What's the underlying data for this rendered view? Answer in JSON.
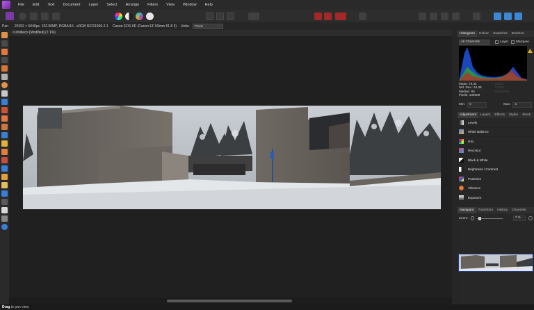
{
  "menubar": {
    "items": [
      "File",
      "Edit",
      "Text",
      "Document",
      "Layer",
      "Select",
      "Arrange",
      "Filters",
      "View",
      "Window",
      "Help"
    ]
  },
  "context_bar": {
    "tool_name": "Pan",
    "doc_info": "20392 × 5046px, 102.90MP, RGBA/16 - sRGB IEC61966-2.1",
    "camera": "Canon EOS 6D (Canon EF 50mm f/1.8 II)",
    "units_label": "Units:",
    "units_value": "Pixels"
  },
  "document_tab": {
    "title": "<Untitled> [Modified] (7.1%)"
  },
  "histogram_panel": {
    "tabs": [
      "Histogram",
      "Colour",
      "Swatches",
      "Brushes"
    ],
    "active_tab": "Histogram",
    "channel_select": "All Channels",
    "layer_label": "Layer",
    "marquee_label": "Marquee",
    "stats": {
      "mean": "Mean: 79.34",
      "std_dev": "Std. Dev.: 44.39",
      "median": "Median: 66",
      "pixels": "Pixels: 100009"
    },
    "faint_stats": {
      "level": "Level:",
      "count": "Count:",
      "percentile": "Percentile:"
    },
    "min_label": "Min:",
    "min_value": "0",
    "max_label": "Max:",
    "max_value": "1"
  },
  "adjustment_panel": {
    "tabs": [
      "Adjustment",
      "Layers",
      "Effects",
      "Styles",
      "Stock"
    ],
    "active_tab": "Adjustment",
    "items": [
      {
        "label": "Levels",
        "icon": "levels-icon"
      },
      {
        "label": "White Balance",
        "icon": "white-balance-icon"
      },
      {
        "label": "HSL",
        "icon": "hsl-icon"
      },
      {
        "label": "Recolour",
        "icon": "recolour-icon"
      },
      {
        "label": "Black & White",
        "icon": "black-white-icon"
      },
      {
        "label": "Brightness / Contrast",
        "icon": "brightness-contrast-icon"
      },
      {
        "label": "Posterise",
        "icon": "posterise-icon"
      },
      {
        "label": "Vibrance",
        "icon": "vibrance-icon"
      },
      {
        "label": "Exposure",
        "icon": "exposure-icon"
      }
    ]
  },
  "navigator_panel": {
    "tabs": [
      "Navigator",
      "Transform",
      "History",
      "Channels"
    ],
    "active_tab": "Navigator",
    "zoom_label": "Zoom:",
    "zoom_value": "7 %"
  },
  "status_bar": {
    "bold": "Drag",
    "rest": " to pan view."
  },
  "colors": {
    "accent": "#7a3ba8",
    "background": "#1f1f1f",
    "panel": "#272727"
  }
}
